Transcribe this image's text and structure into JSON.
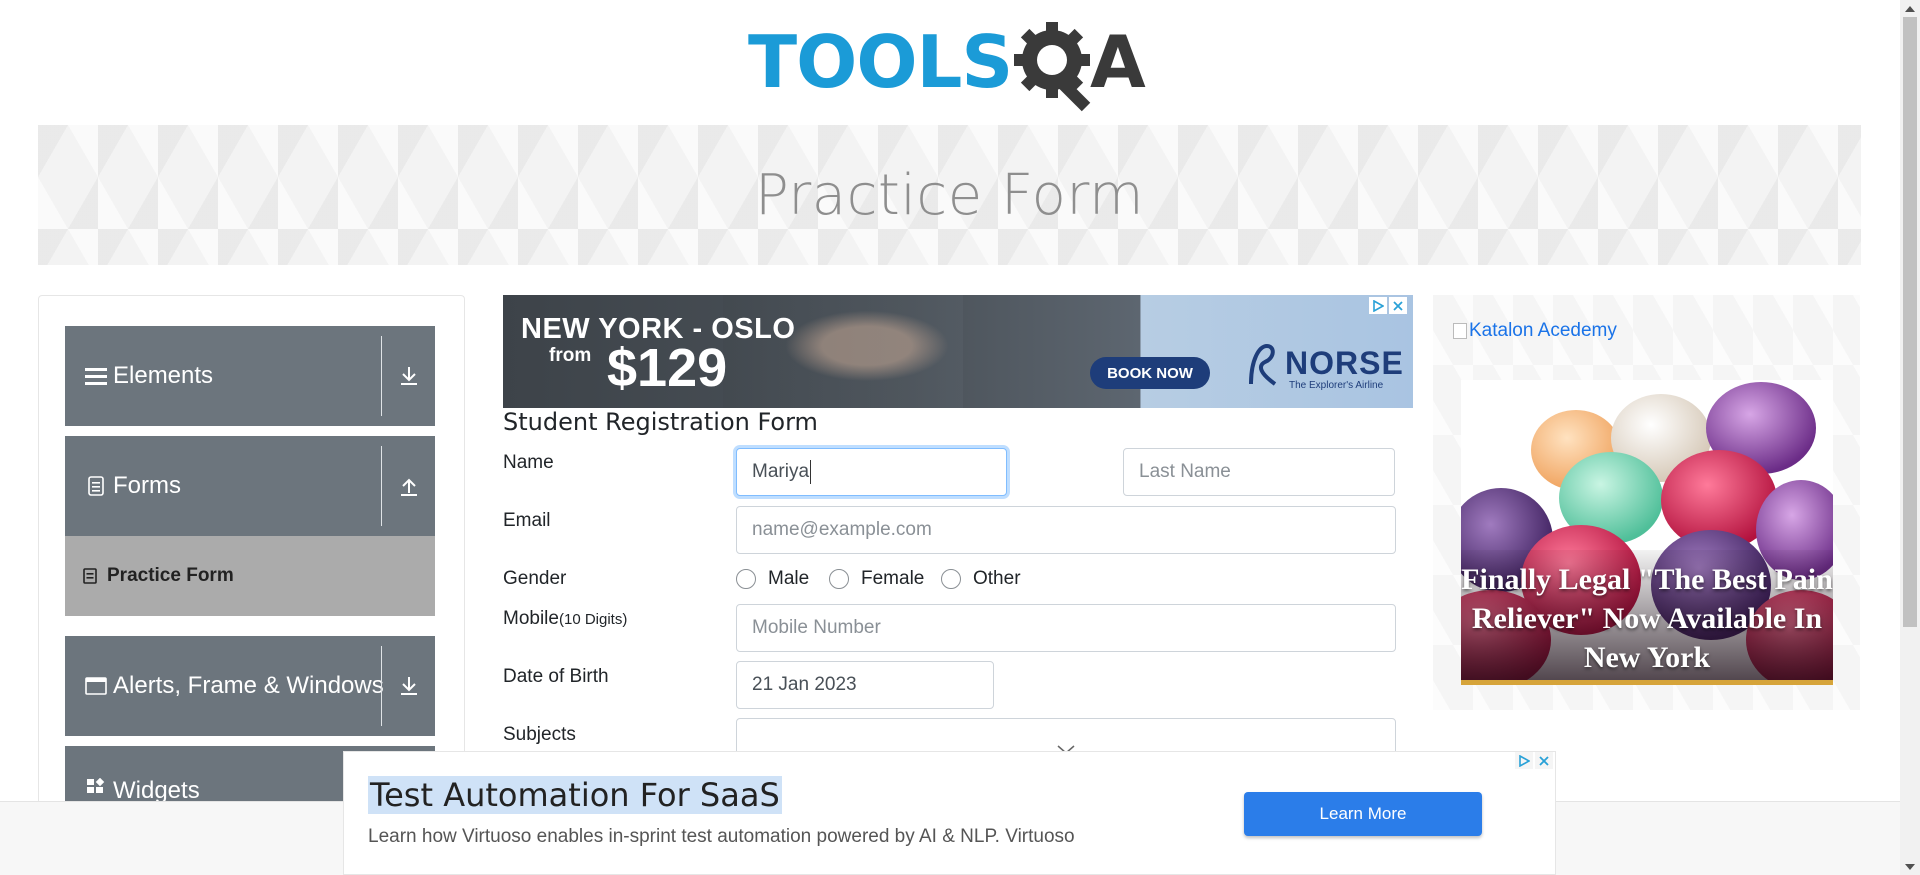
{
  "logo": {
    "part1": "TOOLS",
    "part2": "A"
  },
  "banner": {
    "title": "Practice Form"
  },
  "sidebar": {
    "groups": [
      {
        "label": "Elements"
      },
      {
        "label": "Forms"
      },
      {
        "label": "Alerts, Frame & Windows"
      },
      {
        "label": "Widgets"
      }
    ],
    "active_item": "Practice Form"
  },
  "ad_top": {
    "route": "NEW YORK - OSLO",
    "from": "from",
    "price": "$129",
    "cta": "BOOK NOW",
    "brand": "NORSE",
    "tagline": "The Explorer's Airline"
  },
  "form": {
    "title": "Student Registration Form",
    "name_label": "Name",
    "first_name_value": "Mariya",
    "last_name_placeholder": "Last Name",
    "email_label": "Email",
    "email_placeholder": "name@example.com",
    "gender_label": "Gender",
    "gender_options": [
      "Male",
      "Female",
      "Other"
    ],
    "mobile_label": "Mobile",
    "mobile_hint": "(10 Digits)",
    "mobile_placeholder": "Mobile Number",
    "dob_label": "Date of Birth",
    "dob_value": "21 Jan 2023",
    "subjects_label": "Subjects"
  },
  "ad_right": {
    "image_alt": "Katalon Acedemy",
    "headline": "Finally Legal \"The Best Pain Reliever\" Now Available In New York"
  },
  "ad_bottom": {
    "headline": "Test Automation For SaaS",
    "subtext": "Learn how Virtuoso enables in-sprint test automation powered by AI & NLP. Virtuoso",
    "cta": "Learn More"
  },
  "colors": {
    "logo_blue": "#1b9bd7",
    "logo_dark": "#3a3a3a",
    "nav_group_bg": "#6c757d",
    "nav_active_bg": "#ababab",
    "focus_border": "#80bdff",
    "ad_cta": "#2b7de9"
  }
}
